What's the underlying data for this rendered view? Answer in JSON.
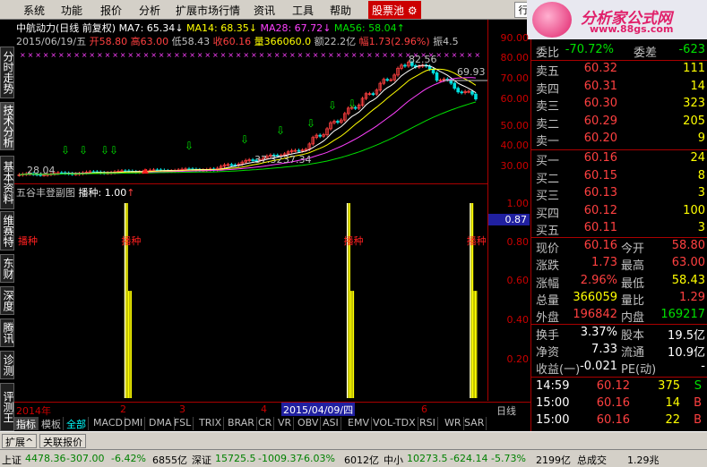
{
  "menu": [
    "系统",
    "功能",
    "报价",
    "分析",
    "扩展市场行情",
    "资讯",
    "工具",
    "帮助"
  ],
  "stock_pool_label": "股票池",
  "logo": {
    "text": "分析家公式网",
    "url": "www.88gs.com"
  },
  "right_tab_label": "行",
  "left_tabs": [
    "分时走势",
    "技术分析",
    "基本资料",
    "维赛特",
    "东财",
    "深度",
    "腾讯",
    "诊测",
    "评测王"
  ],
  "main_chart": {
    "title": "中航动力(日线 前复权)",
    "ma7": "MA7: 65.34",
    "ma14": "MA14: 68.35",
    "ma28": "MA28: 67.72",
    "ma56": "MA56: 58.04",
    "date": "2015/06/19/五",
    "open": "开58.80",
    "high": "高63.00",
    "low": "低58.43",
    "close": "收60.16",
    "volume": "量366060.0",
    "amount": "额22.2亿",
    "change": "幅1.73(2.96%)",
    "amplitude": "振4.5",
    "annotations": [
      "82.56",
      "69.93",
      "37.32",
      "37.34",
      "28.04"
    ],
    "y_ticks": [
      "90.00",
      "80.00",
      "70.00",
      "60.00",
      "50.00",
      "40.00",
      "30.00"
    ]
  },
  "sub_chart": {
    "title": "五谷丰登副图",
    "param": "播种: 1.00",
    "signal_label": "播种",
    "signal_positions": [
      0.245,
      0.715,
      0.975
    ],
    "y_ticks": [
      "1.00",
      "0.80",
      "0.60",
      "0.40",
      "0.20"
    ],
    "cursor_value": "0.87"
  },
  "date_strip": {
    "labels": [
      "2014年",
      "2",
      "3",
      "4",
      "5",
      "6"
    ],
    "cursor": "2015/04/09/四",
    "period": "日线"
  },
  "indicator_tabs": [
    "指标",
    "模板",
    "全部",
    "MACD",
    "DMI",
    "DMA",
    "FSL",
    "TRIX",
    "BRAR",
    "CR",
    "VR",
    "OBV",
    "ASI",
    "EMV",
    "VOL-TDX",
    "RSI",
    "WR",
    "SAR"
  ],
  "bottom_tabs": [
    "扩展^",
    "关联报价"
  ],
  "ticker": {
    "sh_label": "上证",
    "sh_value": "4478.36",
    "sh_change": "-307.00",
    "sh_pct": "-6.42%",
    "sh_amount": "6855亿",
    "sz_label": "深证",
    "sz_value": "15725.5",
    "sz_change": "-1009.37",
    "sz_pct": "-6.03%",
    "sz_amount": "6012亿",
    "zx_label": "中小",
    "zx_value": "10273.5",
    "zx_change": "-624.14",
    "zx_pct": "-5.73%",
    "zx_amount": "2199亿",
    "total_label": "总成交",
    "total_value": "1.29兆"
  },
  "quote": {
    "header": {
      "weibi_label": "委比",
      "weibi_value": "-70.72%",
      "weicha_label": "委差",
      "weicha_value": "-623"
    },
    "sell": [
      {
        "label": "卖五",
        "price": "60.32",
        "vol": "111"
      },
      {
        "label": "卖四",
        "price": "60.31",
        "vol": "14"
      },
      {
        "label": "卖三",
        "price": "60.30",
        "vol": "323"
      },
      {
        "label": "卖二",
        "price": "60.29",
        "vol": "205"
      },
      {
        "label": "卖一",
        "price": "60.20",
        "vol": "9"
      }
    ],
    "buy": [
      {
        "label": "买一",
        "price": "60.16",
        "vol": "24"
      },
      {
        "label": "买二",
        "price": "60.15",
        "vol": "8"
      },
      {
        "label": "买三",
        "price": "60.13",
        "vol": "3"
      },
      {
        "label": "买四",
        "price": "60.12",
        "vol": "100"
      },
      {
        "label": "买五",
        "price": "60.11",
        "vol": "3"
      }
    ],
    "stats": [
      {
        "l1": "现价",
        "v1": "60.16",
        "l2": "今开",
        "v2": "58.80"
      },
      {
        "l1": "涨跌",
        "v1": "1.73",
        "l2": "最高",
        "v2": "63.00"
      },
      {
        "l1": "涨幅",
        "v1": "2.96%",
        "l2": "最低",
        "v2": "58.43"
      },
      {
        "l1": "总量",
        "v1": "366059",
        "l2": "量比",
        "v2": "1.29"
      },
      {
        "l1": "外盘",
        "v1": "196842",
        "l2": "内盘",
        "v2": "169217"
      }
    ],
    "fundamentals": [
      {
        "l1": "换手",
        "v1": "3.37%",
        "l2": "股本",
        "v2": "19.5亿"
      },
      {
        "l1": "净资",
        "v1": "7.33",
        "l2": "流通",
        "v2": "10.9亿"
      },
      {
        "l1": "收益(一)",
        "v1": "-0.021",
        "l2": "PE(动)",
        "v2": "-"
      }
    ],
    "ticks": [
      {
        "time": "14:59",
        "price": "60.12",
        "vol": "375",
        "flag": "S"
      },
      {
        "time": "15:00",
        "price": "60.16",
        "vol": "14",
        "flag": "B"
      },
      {
        "time": "15:00",
        "price": "60.16",
        "vol": "22",
        "flag": "B"
      }
    ],
    "tabs": [
      "笔",
      "价",
      "细",
      "势",
      "指",
      "联",
      "值",
      "主"
    ]
  },
  "colors": {
    "up": "#ff4040",
    "down": "#00e000",
    "ma7": "#ffffff",
    "ma14": "#ffff00",
    "ma28": "#ff40ff",
    "ma56": "#00e000",
    "signal": "#ffff00"
  }
}
